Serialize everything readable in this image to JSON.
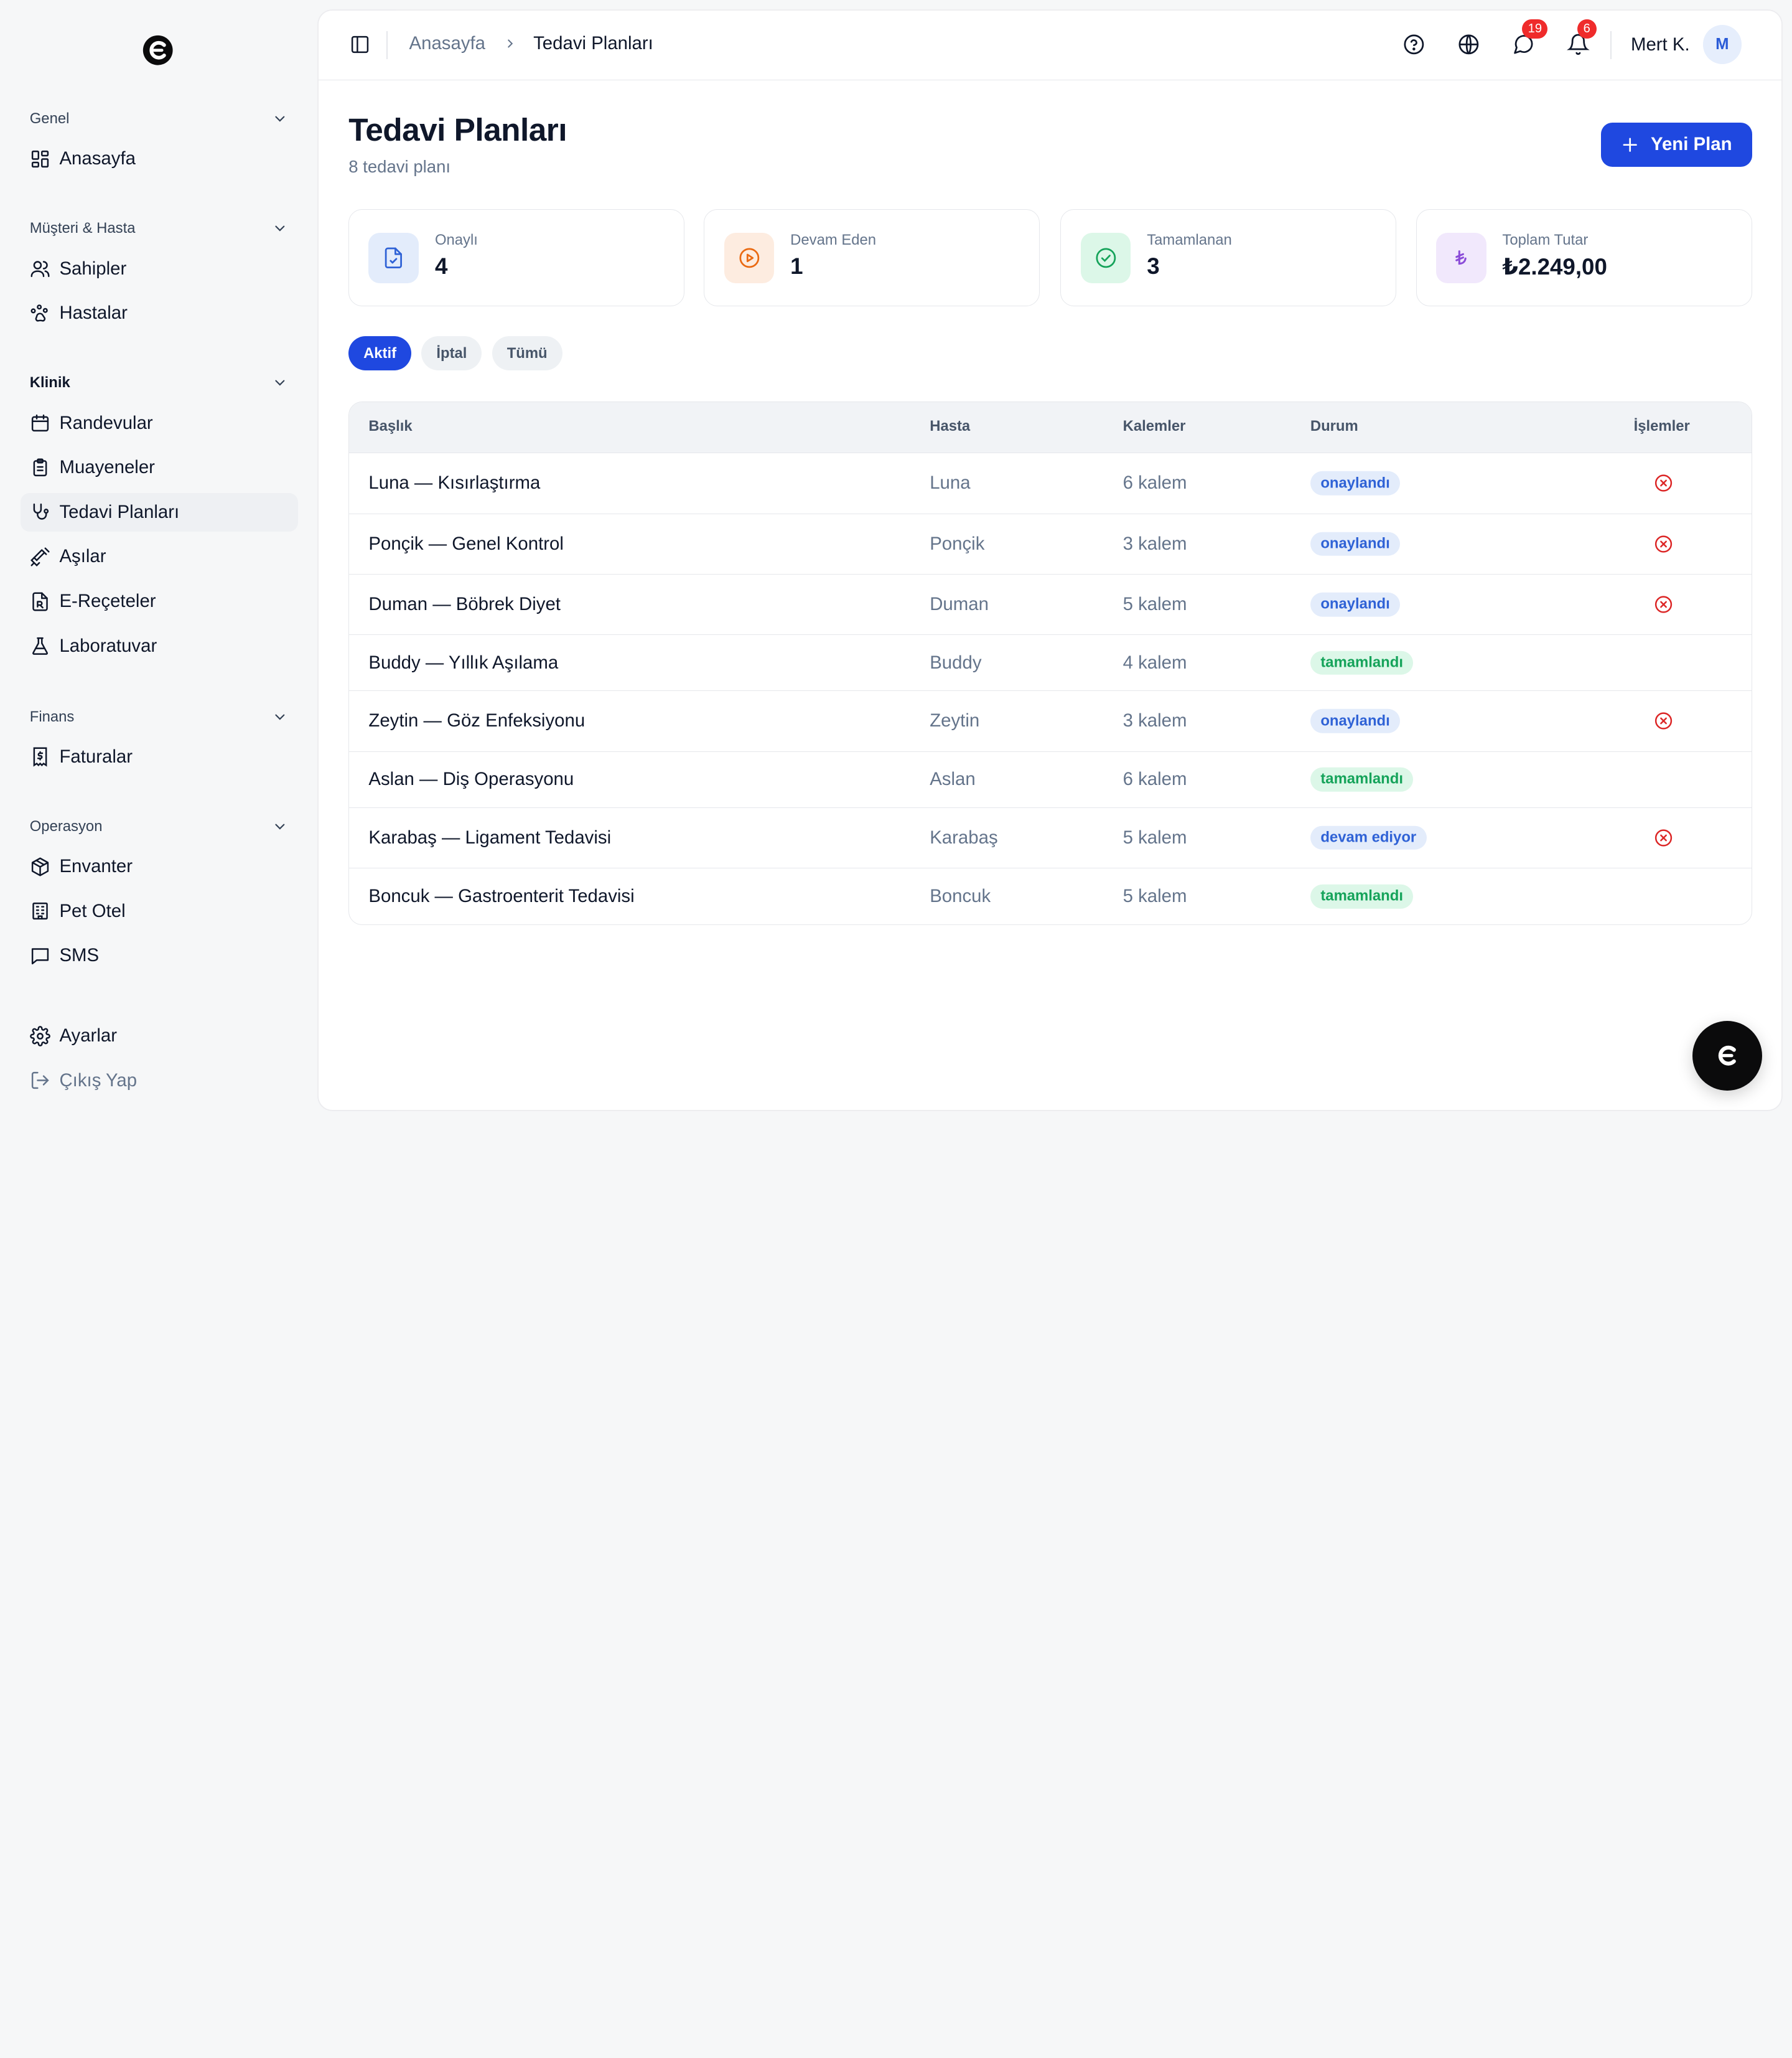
{
  "sidebar": {
    "sections": [
      {
        "label": "Genel",
        "items": [
          {
            "label": "Anasayfa",
            "icon": "dashboard-icon"
          }
        ]
      },
      {
        "label": "Müşteri & Hasta",
        "items": [
          {
            "label": "Sahipler",
            "icon": "users-icon"
          },
          {
            "label": "Hastalar",
            "icon": "paw-icon"
          }
        ]
      },
      {
        "label": "Klinik",
        "items": [
          {
            "label": "Randevular",
            "icon": "calendar-icon"
          },
          {
            "label": "Muayeneler",
            "icon": "clipboard-icon"
          },
          {
            "label": "Tedavi Planları",
            "icon": "stethoscope-icon"
          },
          {
            "label": "Aşılar",
            "icon": "syringe-icon"
          },
          {
            "label": "E-Reçeteler",
            "icon": "prescription-icon"
          },
          {
            "label": "Laboratuvar",
            "icon": "flask-icon"
          }
        ]
      },
      {
        "label": "Finans",
        "items": [
          {
            "label": "Faturalar",
            "icon": "invoice-icon"
          }
        ]
      },
      {
        "label": "Operasyon",
        "items": [
          {
            "label": "Envanter",
            "icon": "package-icon"
          },
          {
            "label": "Pet Otel",
            "icon": "building-icon"
          },
          {
            "label": "SMS",
            "icon": "message-icon"
          }
        ]
      }
    ],
    "settings_label": "Ayarlar",
    "logout_label": "Çıkış Yap"
  },
  "topbar": {
    "breadcrumb_home": "Anasayfa",
    "breadcrumb_current": "Tedavi Planları",
    "messages_badge": "19",
    "notifications_badge": "6",
    "user_name": "Mert K.",
    "avatar_initial": "M"
  },
  "page": {
    "title": "Tedavi Planları",
    "subtitle": "8 tedavi planı",
    "new_button": "Yeni Plan"
  },
  "stats": [
    {
      "label": "Onaylı",
      "value": "4",
      "color": "#2f62d6"
    },
    {
      "label": "Devam Eden",
      "value": "1",
      "color": "#ea6a12"
    },
    {
      "label": "Tamamlanan",
      "value": "3",
      "color": "#15a35a"
    },
    {
      "label": "Toplam Tutar",
      "value": "₺2.249,00",
      "color": "#8b4bd8"
    }
  ],
  "filters": [
    "Aktif",
    "İptal",
    "Tümü"
  ],
  "table": {
    "headers": [
      "Başlık",
      "Hasta",
      "Kalemler",
      "Durum",
      "İşlemler"
    ],
    "rows": [
      {
        "title": "Luna — Kısırlaştırma",
        "hasta": "Luna",
        "kalem": "6 kalem",
        "durum": "onaylandı"
      },
      {
        "title": "Ponçik — Genel Kontrol",
        "hasta": "Ponçik",
        "kalem": "3 kalem",
        "durum": "onaylandı"
      },
      {
        "title": "Duman — Böbrek Diyet",
        "hasta": "Duman",
        "kalem": "5 kalem",
        "durum": "onaylandı"
      },
      {
        "title": "Buddy — Yıllık Aşılama",
        "hasta": "Buddy",
        "kalem": "4 kalem",
        "durum": "tamamlandı"
      },
      {
        "title": "Zeytin — Göz Enfeksiyonu",
        "hasta": "Zeytin",
        "kalem": "3 kalem",
        "durum": "onaylandı"
      },
      {
        "title": "Aslan — Diş Operasyonu",
        "hasta": "Aslan",
        "kalem": "6 kalem",
        "durum": "tamamlandı"
      },
      {
        "title": "Karabaş — Ligament Tedavisi",
        "hasta": "Karabaş",
        "kalem": "5 kalem",
        "durum": "devam ediyor"
      },
      {
        "title": "Boncuk — Gastroenterit Tedavisi",
        "hasta": "Boncuk",
        "kalem": "5 kalem",
        "durum": "tamamlandı"
      }
    ]
  },
  "colors": {
    "accent": "#1f48e0",
    "danger": "#dc2626"
  }
}
